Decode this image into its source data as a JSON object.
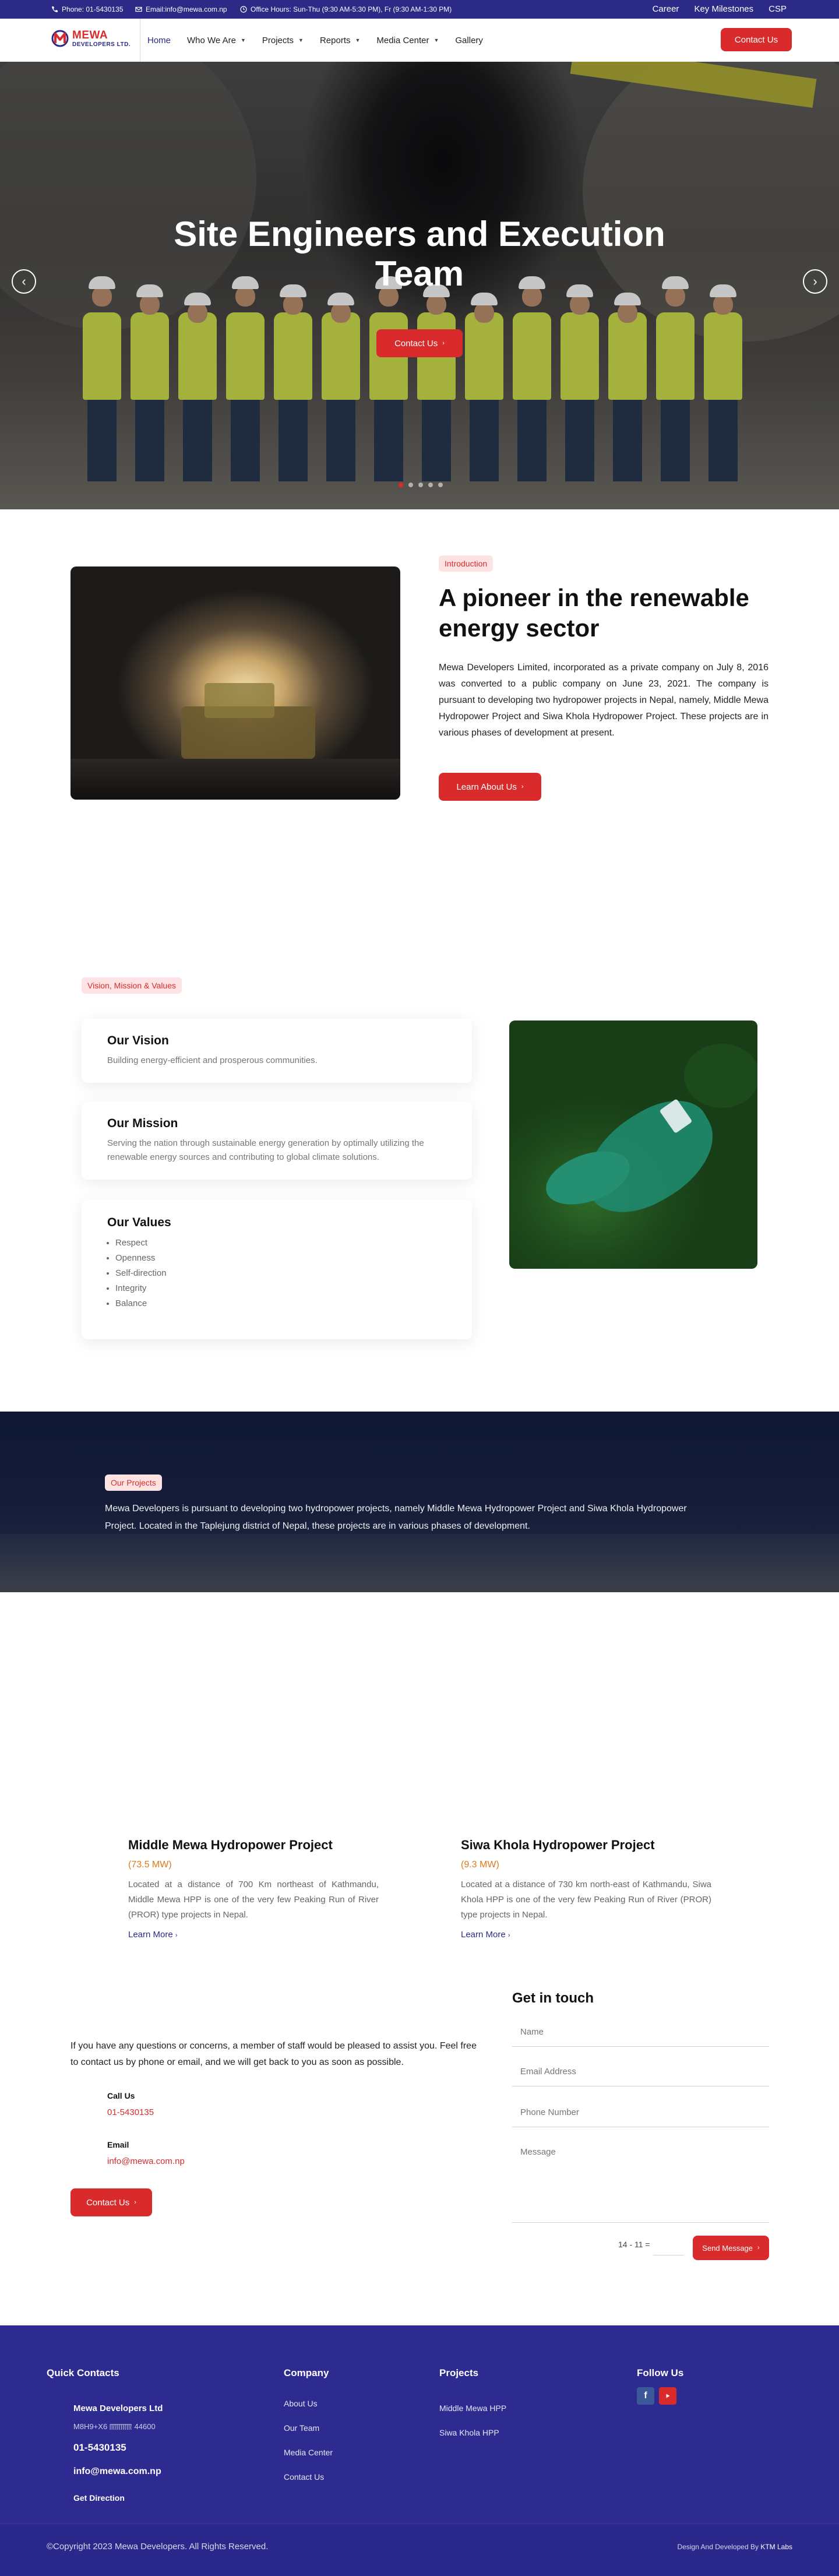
{
  "topbar": {
    "phone": "Phone: 01-5430135",
    "email": "Email:info@mewa.com.np",
    "hours": "Office Hours: Sun-Thu (9:30 AM-5:30 PM), Fr (9:30 AM-1:30 PM)",
    "links": [
      "Career",
      "Key Milestones",
      "CSP"
    ]
  },
  "logo": {
    "line1": "MEWA",
    "line2": "DEVELOPERS LTD."
  },
  "nav": {
    "items": [
      {
        "label": "Home",
        "has_menu": false
      },
      {
        "label": "Who We Are",
        "has_menu": true
      },
      {
        "label": "Projects",
        "has_menu": true
      },
      {
        "label": "Reports",
        "has_menu": true
      },
      {
        "label": "Media Center",
        "has_menu": true
      },
      {
        "label": "Gallery",
        "has_menu": false
      }
    ],
    "cta": "Contact Us"
  },
  "hero": {
    "title": "Site Engineers and Execution Team",
    "cta": "Contact Us",
    "slides": 5,
    "active_slide": 1
  },
  "intro": {
    "tag": "Introduction",
    "title": "A pioneer in the renewable energy sector",
    "body": "Mewa Developers Limited, incorporated as a private company on July 8, 2016 was converted to a public company on June 23, 2021.  The company is pursuant to developing two hydropower projects in Nepal, namely, Middle Mewa Hydropower Project and Siwa Khola Hydropower Project. These projects are in various phases of development at present.",
    "cta": "Learn About Us"
  },
  "vmv": {
    "tag": "Vision, Mission & Values",
    "vision": {
      "title": "Our Vision",
      "text": "Building energy-efficient and prosperous communities."
    },
    "mission": {
      "title": "Our Mission",
      "text": "Serving the nation through sustainable energy generation by optimally utilizing the renewable energy sources and contributing to global climate solutions."
    },
    "values": {
      "title": "Our Values",
      "items": [
        "Respect",
        "Openness",
        "Self-direction",
        "Integrity",
        "Balance"
      ]
    }
  },
  "projects": {
    "tag": "Our Projects",
    "text": "Mewa Developers is pursuant to developing two hydropower projects, namely Middle Mewa Hydropower Project and Siwa Khola Hydropower Project. Located in the Taplejung district of Nepal, these projects are in various phases of development.",
    "items": [
      {
        "title": "Middle Mewa Hydropower Project",
        "capacity": "(73.5 MW)",
        "text": "Located at a distance of 700 Km northeast of Kathmandu, Middle Mewa HPP is one of the very few Peaking Run of River (PROR) type projects in Nepal.",
        "link": "Learn More"
      },
      {
        "title": "Siwa Khola Hydropower Project",
        "capacity": "(9.3 MW)",
        "text": "Located at a distance of 730 km north-east of Kathmandu, Siwa Khola HPP is one of the very few Peaking Run of River (PROR) type projects in Nepal.",
        "link": "Learn More"
      }
    ]
  },
  "contact": {
    "intro": "If you have any questions or concerns, a member of staff would be pleased to assist you. Feel free to contact us by phone or email, and we will get back to you as soon as possible.",
    "call_label": "Call Us",
    "call_value": "01-5430135",
    "email_label": "Email",
    "email_value": "info@mewa.com.np",
    "cta": "Contact Us",
    "form": {
      "title": "Get in touch",
      "name": "Name",
      "email": "Email Address",
      "phone": "Phone Number",
      "message": "Message",
      "captcha": "14 - 11 =",
      "submit": "Send Message"
    }
  },
  "footer": {
    "quick": {
      "title": "Quick Contacts",
      "company": "Mewa Developers Ltd",
      "address": "M8H9+X6 ꡕꡕꡕꡕ 44600",
      "phone": "01-5430135",
      "email": "info@mewa.com.np",
      "directions": "Get Direction"
    },
    "company": {
      "title": "Company",
      "links": [
        "About Us",
        "Our Team",
        "Media Center",
        "Contact Us"
      ]
    },
    "projects": {
      "title": "Projects",
      "links": [
        "Middle Mewa HPP",
        "Siwa Khola HPP"
      ]
    },
    "follow": {
      "title": "Follow Us"
    },
    "copyright": "©Copyright 2023 Mewa Developers. All Rights Reserved.",
    "credit_prefix": "Design And Developed By",
    "credit_name": "KTM Labs"
  },
  "colors": {
    "brand": "#2b2a86",
    "accent": "#d92b2b",
    "capacity": "#e07a1a"
  }
}
